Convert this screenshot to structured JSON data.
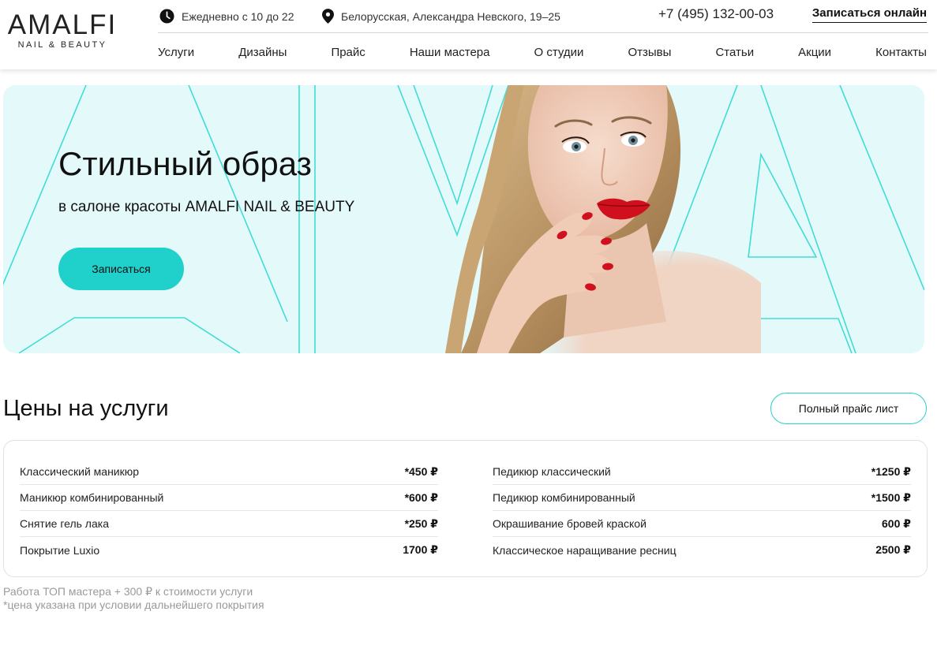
{
  "brand": {
    "name": "AMALFI",
    "tagline": "NAIL & BEAUTY"
  },
  "header": {
    "hours": "Ежедневно с 10 до 22",
    "address": "Белорусская, Александра Невского, 19–25",
    "phone": "+7 (495) 132-00-03",
    "book_online": "Записаться онлайн"
  },
  "nav": [
    {
      "label": "Услуги"
    },
    {
      "label": "Дизайны"
    },
    {
      "label": "Прайс"
    },
    {
      "label": "Наши мастера"
    },
    {
      "label": "О студии"
    },
    {
      "label": "Отзывы"
    },
    {
      "label": "Статьи"
    },
    {
      "label": "Акции"
    },
    {
      "label": "Контакты"
    }
  ],
  "hero": {
    "title": "Стильный образ",
    "subtitle": "в салоне красоты AMALFI NAIL & BEAUTY",
    "button": "Записаться",
    "accent_color": "#1fd0cb",
    "background_color": "#e4f9f9"
  },
  "prices": {
    "title": "Цены на услуги",
    "full_list_button": "Полный прайс лист",
    "left": [
      {
        "name": "Классический маникюр",
        "price": "*450 ₽"
      },
      {
        "name": "Маникюр комбинированный",
        "price": "*600 ₽"
      },
      {
        "name": "Снятие гель лака",
        "price": "*250 ₽"
      },
      {
        "name": "Покрытие Luxio",
        "price": "1700 ₽"
      }
    ],
    "right": [
      {
        "name": "Педикюр классический",
        "price": "*1250 ₽"
      },
      {
        "name": "Педикюр комбинированный",
        "price": "*1500 ₽"
      },
      {
        "name": "Окрашивание бровей краской",
        "price": "600 ₽"
      },
      {
        "name": "Классическое наращивание ресниц",
        "price": "2500 ₽"
      }
    ],
    "note_top_master": "Работа ТОП мастера + 300 ₽ к стоимости услуги",
    "note_asterisk": "*цена указана при условии дальнейшего покрытия"
  },
  "icons": {
    "hours": "clock-icon",
    "address": "map-pin-icon"
  }
}
